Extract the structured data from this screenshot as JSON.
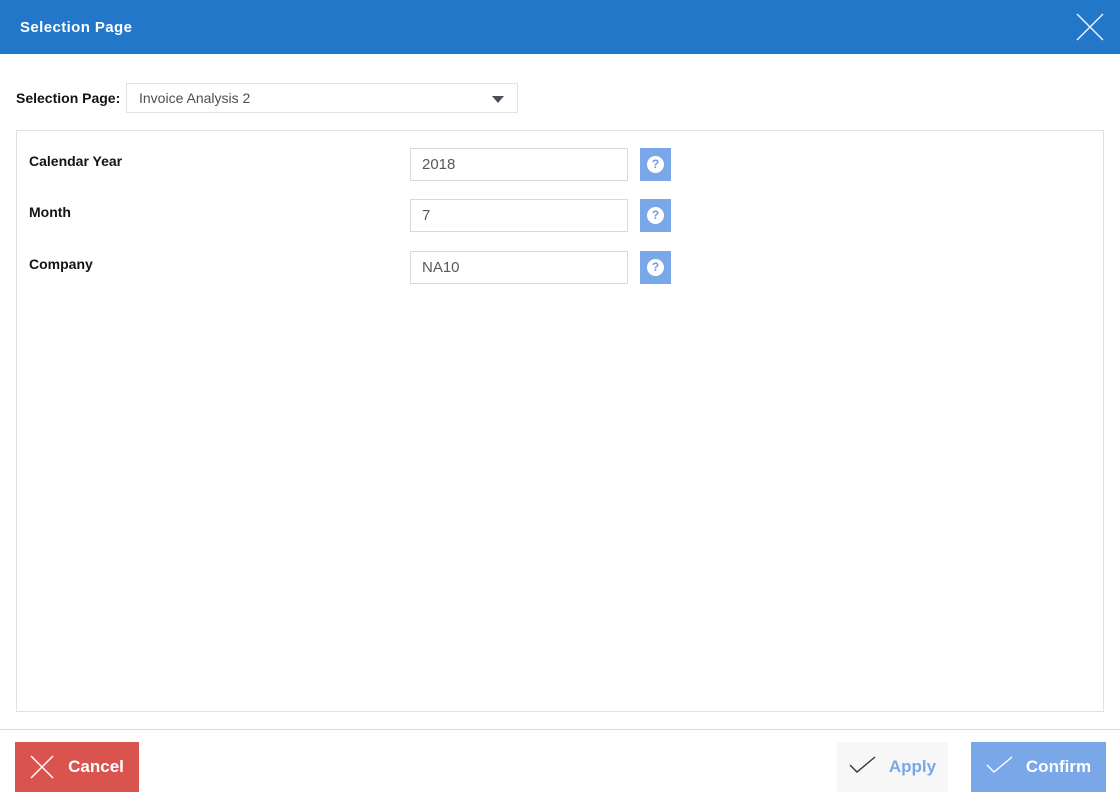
{
  "header": {
    "title": "Selection Page"
  },
  "selector": {
    "label": "Selection Page:",
    "value": "Invoice Analysis 2"
  },
  "form": {
    "fields": [
      {
        "label": "Calendar Year",
        "value": "2018"
      },
      {
        "label": "Month",
        "value": "7"
      },
      {
        "label": "Company",
        "value": "NA10"
      }
    ]
  },
  "icons": {
    "close": "✕",
    "help": "?",
    "dropdown_arrow": "▼",
    "cancel_x": "✕",
    "check": "✓"
  },
  "footer": {
    "cancel_label": "Cancel",
    "apply_label": "Apply",
    "confirm_label": "Confirm"
  },
  "colors": {
    "header_blue": "#2277c8",
    "accent_light_blue": "#7aa7e8",
    "cancel_red": "#d9534f",
    "apply_bg": "#f7f7f7",
    "input_border": "#d9d9d9",
    "panel_border": "#e1e1e1"
  }
}
